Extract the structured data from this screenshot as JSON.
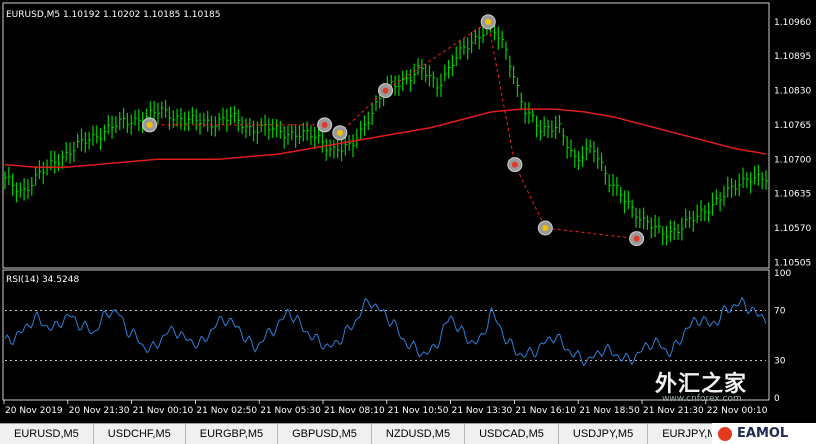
{
  "main_title": "EURUSD,M5  1.10192 1.10202 1.10185 1.10185",
  "rsi_title": "RSI(14) 34.5248",
  "watermark": "外汇之家",
  "watermark_url": "www.cnforex.com",
  "brand": "EAMOL",
  "colors": {
    "background": "#000000",
    "price_bars": "#00d000",
    "moving_average": "#e01c1c",
    "rsi_line": "#2f7fd8",
    "zigzag": "#ff2020",
    "level_line": "#ffffff"
  },
  "tabs": [
    "EURUSD,M5",
    "USDCHF,M5",
    "EURGBP,M5",
    "GBPUSD,M5",
    "NZDUSD,M5",
    "USDCAD,M5",
    "USDJPY,M5",
    "EURJPY,M5"
  ],
  "chart_data": [
    {
      "type": "line",
      "title": "EURUSD,M5  1.10192 1.10202 1.10185 1.10185",
      "y_ticks": [
        "1.10960",
        "1.10895",
        "1.10830",
        "1.10765",
        "1.10700",
        "1.10635",
        "1.10570",
        "1.10505"
      ],
      "ylim": [
        1.105,
        1.1099
      ],
      "x_ticks": [
        "20 Nov 2019",
        "20 Nov 21:30",
        "21 Nov 00:10",
        "21 Nov 02:50",
        "21 Nov 05:30",
        "21 Nov 08:10",
        "21 Nov 10:50",
        "21 Nov 13:30",
        "21 Nov 16:10",
        "21 Nov 18:50",
        "21 Nov 21:30",
        "22 Nov 00:10"
      ],
      "price_path": [
        1.1066,
        1.1064,
        1.1067,
        1.107,
        1.1072,
        1.1074,
        1.1076,
        1.1077,
        1.1078,
        1.1079,
        1.1078,
        1.1077,
        1.1077,
        1.1078,
        1.1076,
        1.1076,
        1.1075,
        1.1075,
        1.1074,
        1.1072,
        1.1072,
        1.1078,
        1.1083,
        1.1085,
        1.1087,
        1.1084,
        1.1089,
        1.1092,
        1.1096,
        1.109,
        1.108,
        1.1075,
        1.1077,
        1.1069,
        1.1073,
        1.1065,
        1.1062,
        1.1058,
        1.1056,
        1.1057,
        1.1059,
        1.1062,
        1.1064,
        1.1067,
        1.1066
      ],
      "moving_average": [
        1.1069,
        1.10685,
        1.10685,
        1.1069,
        1.10695,
        1.107,
        1.107,
        1.107,
        1.10705,
        1.1071,
        1.1072,
        1.1073,
        1.1074,
        1.1075,
        1.1076,
        1.10775,
        1.1079,
        1.10795,
        1.10795,
        1.1079,
        1.1078,
        1.10765,
        1.1075,
        1.10735,
        1.1072,
        1.1071
      ],
      "zigzag": [
        1.10765,
        1.10765,
        1.1075,
        1.1083,
        1.1096,
        1.1069,
        1.1057,
        1.1055
      ]
    },
    {
      "type": "line",
      "title": "RSI(14) 34.5248",
      "y_ticks": [
        "100",
        "70",
        "30",
        "0"
      ],
      "ylim": [
        0,
        100
      ],
      "levels": [
        70,
        30
      ],
      "series": [
        {
          "name": "RSI(14)",
          "values": [
            45,
            48,
            52,
            60,
            64,
            58,
            55,
            62,
            66,
            60,
            56,
            52,
            63,
            70,
            68,
            55,
            50,
            42,
            38,
            45,
            52,
            55,
            48,
            46,
            42,
            50,
            58,
            64,
            60,
            55,
            45,
            40,
            48,
            54,
            60,
            70,
            62,
            55,
            48,
            45,
            40,
            44,
            52,
            58,
            70,
            78,
            72,
            66,
            60,
            48,
            42,
            38,
            35,
            40,
            52,
            66,
            56,
            48,
            44,
            48,
            70,
            58,
            46,
            38,
            34,
            36,
            40,
            46,
            50,
            42,
            36,
            32,
            30,
            34,
            40,
            36,
            33,
            30,
            34,
            40,
            45,
            42,
            36,
            42,
            54,
            60,
            64,
            58,
            62,
            70,
            74,
            76,
            72,
            66,
            64
          ]
        }
      ]
    }
  ]
}
